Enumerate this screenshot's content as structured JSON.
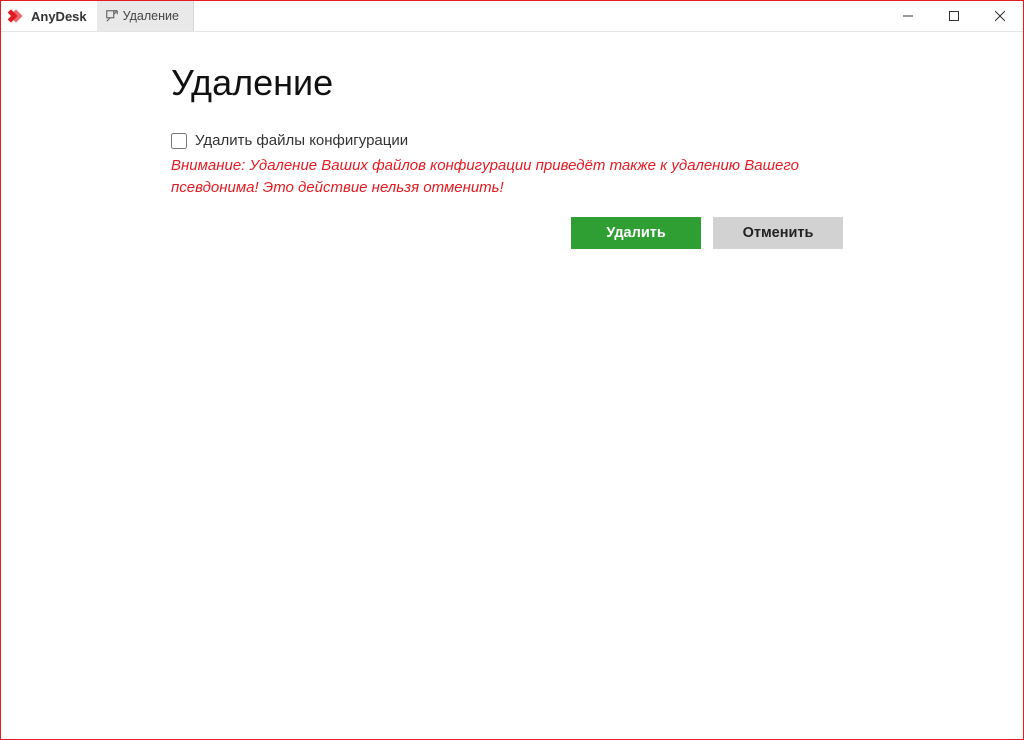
{
  "app": {
    "name": "AnyDesk"
  },
  "tab": {
    "label": "Удаление"
  },
  "page": {
    "title": "Удаление",
    "checkbox_label": "Удалить файлы конфигурации",
    "checkbox_checked": false,
    "warning": "Внимание: Удаление Ваших файлов конфигурации приведёт также к удалению Вашего псевдонима! Это действие нельзя отменить!",
    "buttons": {
      "primary": "Удалить",
      "secondary": "Отменить"
    }
  },
  "colors": {
    "accent": "#e31b23",
    "primary_button": "#2f9e33",
    "secondary_button": "#d2d2d2",
    "warning_text": "#e31b23"
  }
}
